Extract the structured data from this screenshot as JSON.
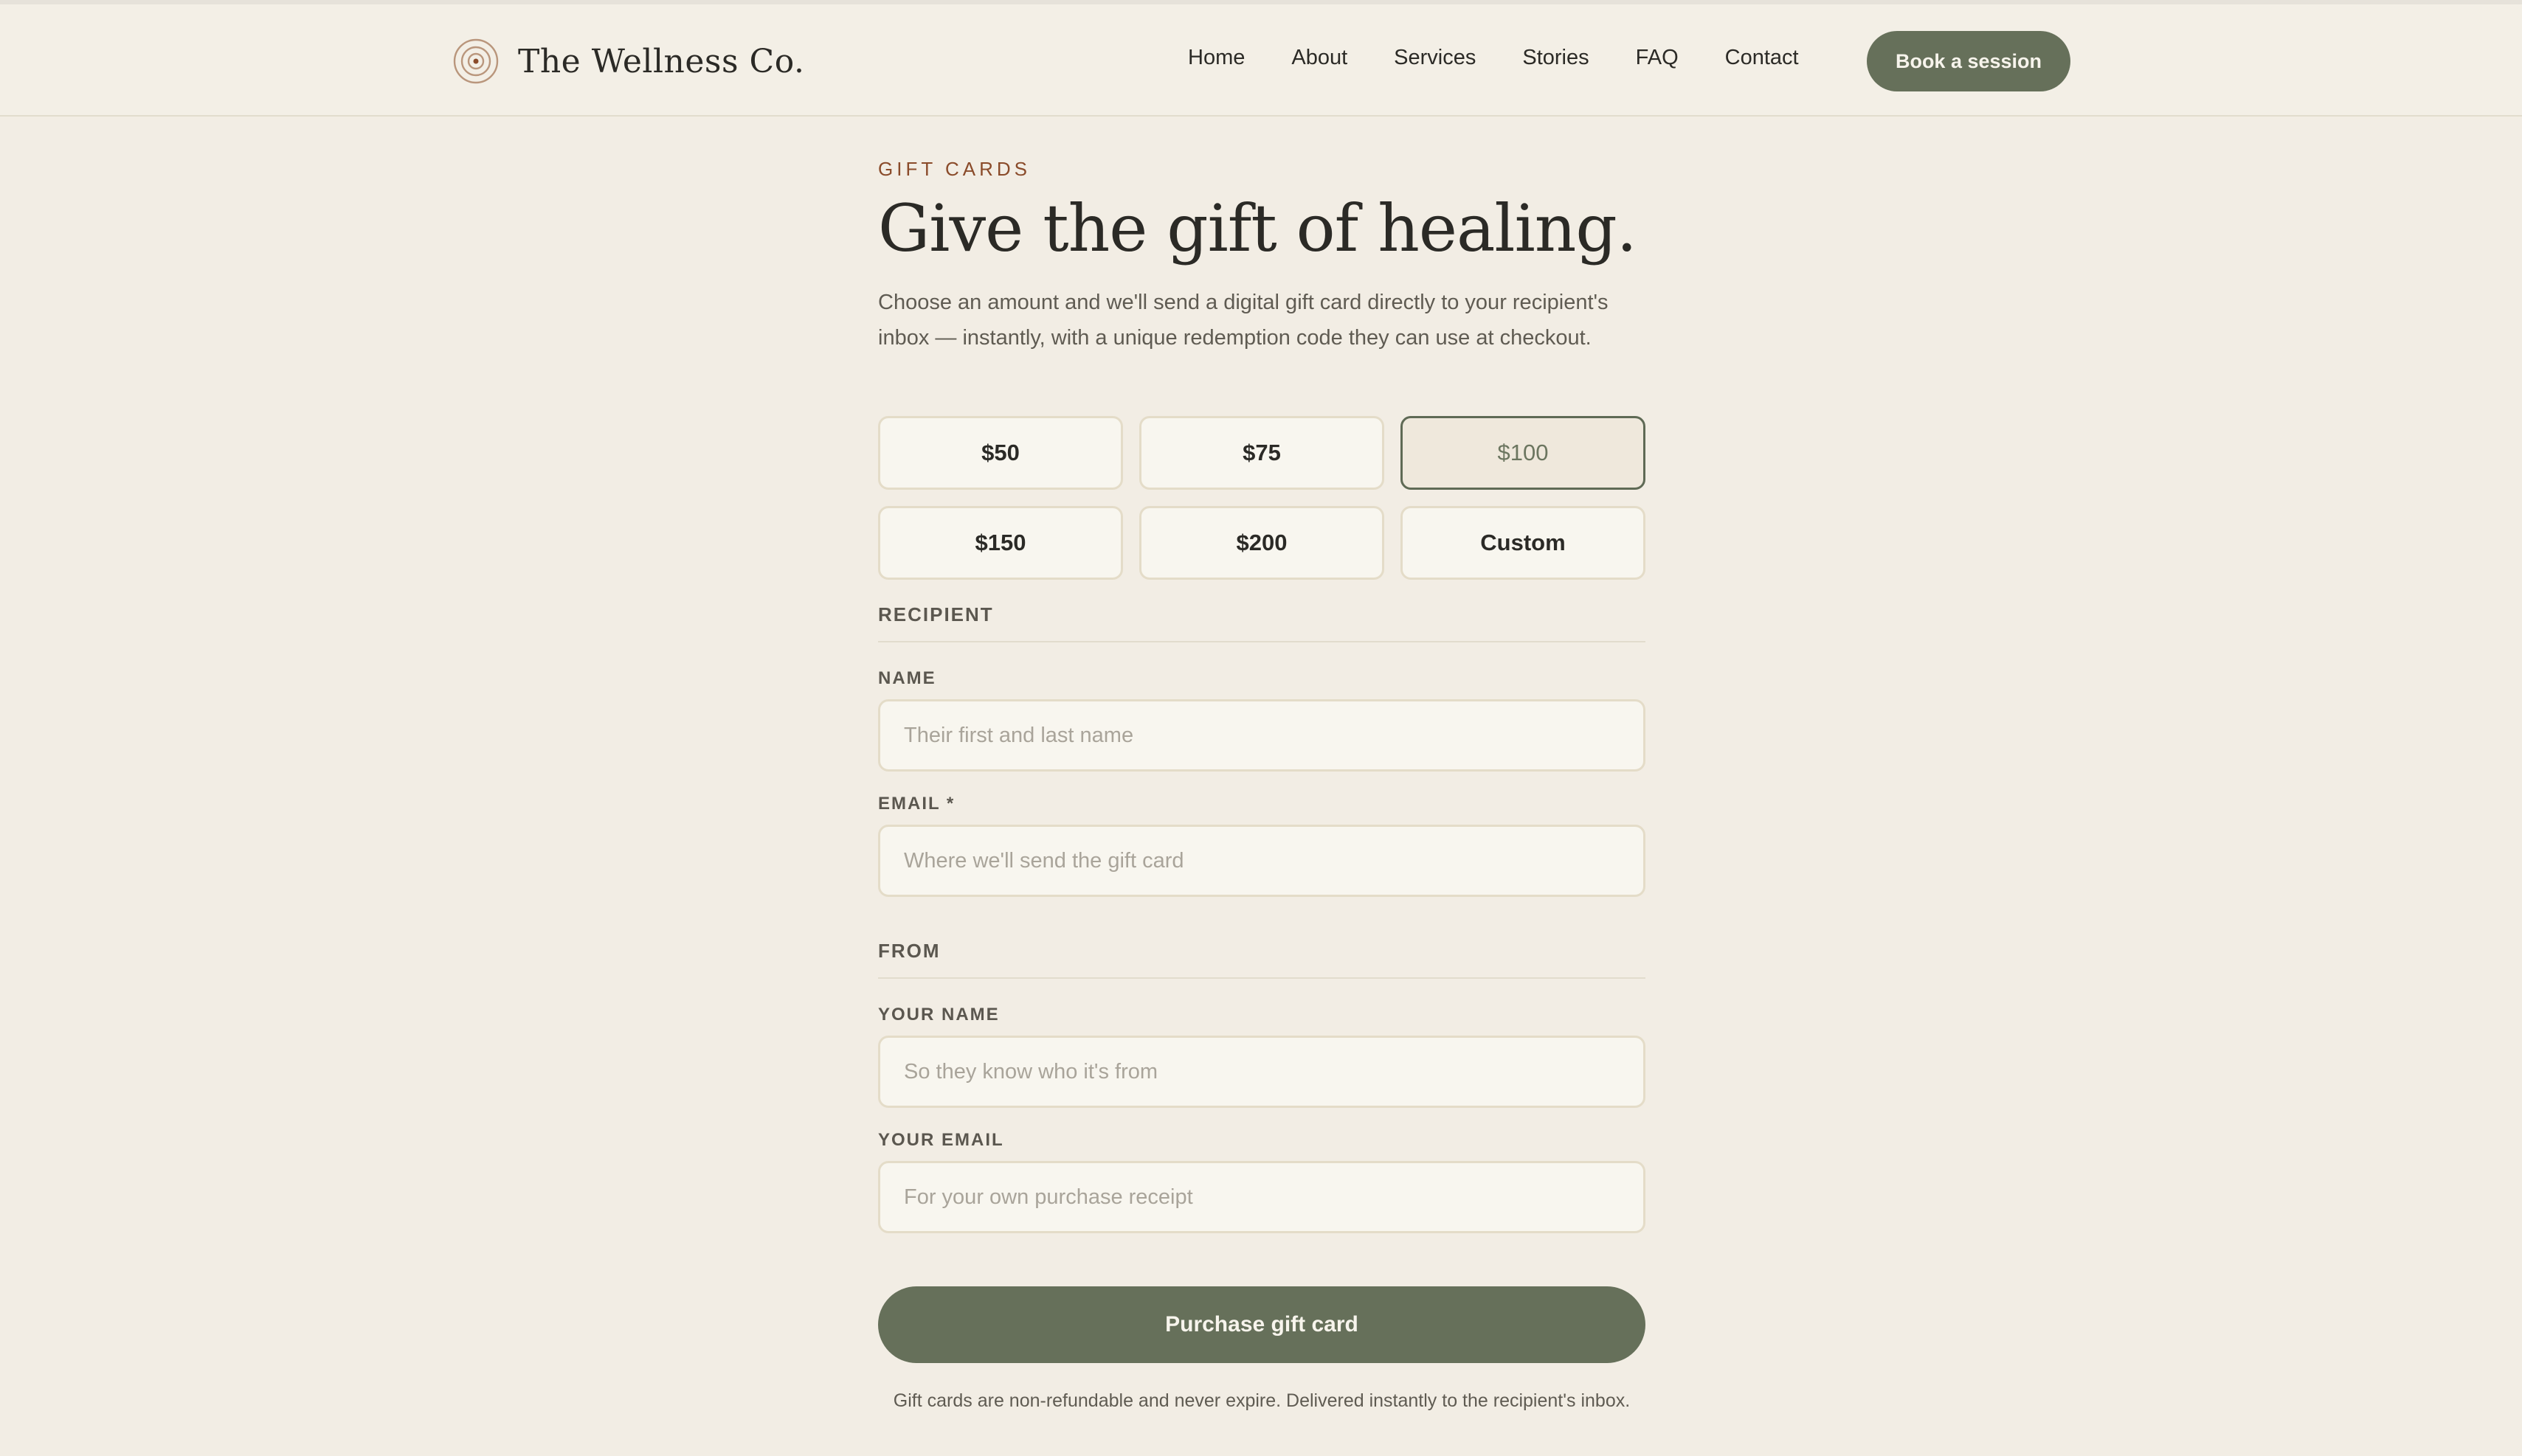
{
  "nav": {
    "brand": "The Wellness Co.",
    "links": [
      "Home",
      "About",
      "Services",
      "Stories",
      "FAQ",
      "Contact"
    ],
    "cta": "Book a session"
  },
  "hero": {
    "eyebrow": "GIFT CARDS",
    "title": "Give the gift of healing.",
    "intro": "Choose an amount and we'll send a digital gift card directly to your recipient's inbox — instantly, with a unique redemption code they can use at checkout."
  },
  "amounts": {
    "options": [
      "$50",
      "$75",
      "$100",
      "$150",
      "$200",
      "Custom"
    ],
    "selected": "$100"
  },
  "recipient": {
    "heading": "RECIPIENT",
    "name_label": "NAME",
    "name_placeholder": "Their first and last name",
    "email_label": "EMAIL *",
    "email_placeholder": "Where we'll send the gift card"
  },
  "from": {
    "heading": "FROM",
    "name_label": "YOUR NAME",
    "name_placeholder": "So they know who it's from",
    "email_label": "YOUR EMAIL",
    "email_placeholder": "For your own purchase receipt"
  },
  "actions": {
    "purchase": "Purchase gift card",
    "fineprint": "Gift cards are non-refundable and never expire. Delivered instantly to the recipient's inbox."
  },
  "colors": {
    "accent": "#66705a",
    "eyebrow": "#8a4b2a",
    "background": "#f2ede4"
  }
}
